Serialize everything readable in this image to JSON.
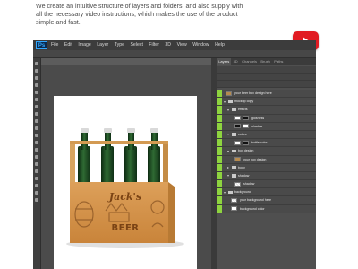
{
  "intro": {
    "line1": "We create an intuitive structure of layers and folders, and also supply with",
    "line2": "all the necessary video instructions, which makes the use of the product",
    "line3": "simple and fast."
  },
  "video": {
    "icon": "youtube-play-icon",
    "color": "#e11b22"
  },
  "app": {
    "logo": "Ps",
    "menu": [
      "File",
      "Edit",
      "Image",
      "Layer",
      "Type",
      "Select",
      "Filter",
      "3D",
      "View",
      "Window",
      "Help"
    ]
  },
  "panel": {
    "tabs": [
      "Layers",
      "3D",
      "Channels",
      "Brush",
      "Paths"
    ],
    "layers": [
      {
        "name": "your beer box design here",
        "kind": "smart"
      },
      {
        "name": "mockup copy",
        "kind": "folder"
      },
      {
        "name": "effects",
        "kind": "folder"
      },
      {
        "name": "glosness",
        "kind": "mask"
      },
      {
        "name": "shadow",
        "kind": "mask"
      },
      {
        "name": "colors",
        "kind": "folder"
      },
      {
        "name": "bottle color",
        "kind": "mask"
      },
      {
        "name": "box design",
        "kind": "folder"
      },
      {
        "name": "your box design",
        "kind": "smart"
      },
      {
        "name": "body",
        "kind": "folder"
      },
      {
        "name": "shadow",
        "kind": "folder"
      },
      {
        "name": "shadow",
        "kind": "layer"
      },
      {
        "name": "background",
        "kind": "folder"
      },
      {
        "name": "your background here",
        "kind": "layer"
      },
      {
        "name": "background color",
        "kind": "layer"
      }
    ]
  },
  "product": {
    "brand": "Jack's",
    "label": "BEER",
    "box_color": "#d2923f",
    "bottle_color": "#1f4d24"
  }
}
